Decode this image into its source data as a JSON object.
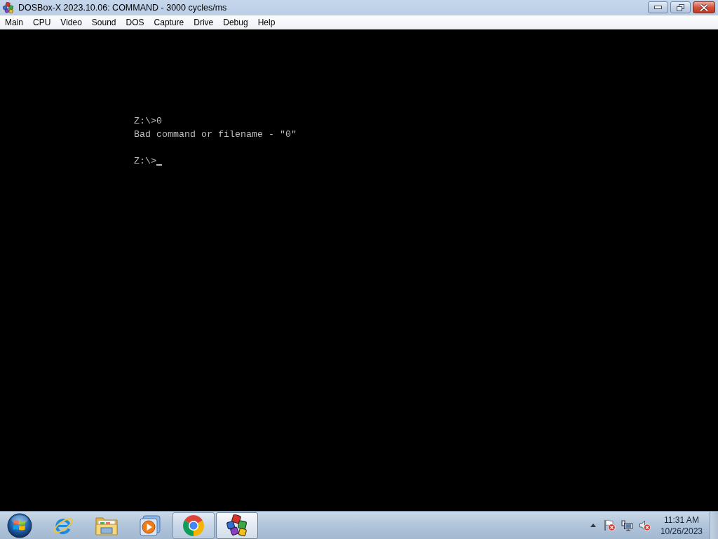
{
  "window": {
    "title": "DOSBox-X 2023.10.06: COMMAND - 3000 cycles/ms"
  },
  "menu": [
    "Main",
    "CPU",
    "Video",
    "Sound",
    "DOS",
    "Capture",
    "Drive",
    "Debug",
    "Help"
  ],
  "console": {
    "history": [
      "Z:\\>0",
      "Bad command or filename - \"0\""
    ],
    "prompt": "Z:\\>"
  },
  "taskbar": {
    "items": [
      {
        "kind": "e-logo",
        "running": false,
        "selected": false
      },
      {
        "kind": "folder",
        "running": false,
        "selected": false
      },
      {
        "kind": "play",
        "running": false,
        "selected": false
      },
      {
        "kind": "ring",
        "running": true,
        "selected": false
      },
      {
        "kind": "blocks",
        "running": true,
        "selected": true
      }
    ]
  },
  "tray": {
    "action_center": {
      "alert": true
    },
    "volume": {
      "muted": true
    },
    "clock": {
      "time": "11:31 AM",
      "date": "10/26/2023"
    }
  }
}
